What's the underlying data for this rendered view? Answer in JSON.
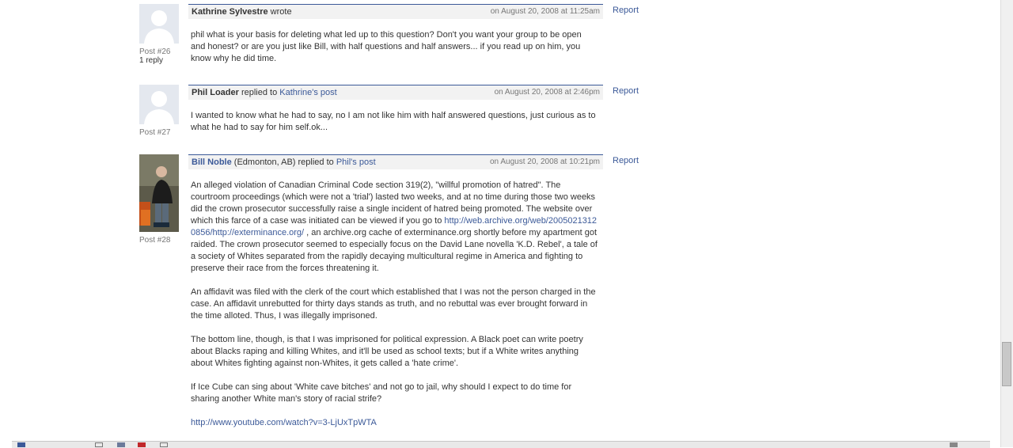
{
  "posts": [
    {
      "author": "Kathrine Sylvestre",
      "action": "wrote",
      "date": "on August 20, 2008 at 11:25am",
      "report": "Report",
      "post_num": "Post #26",
      "replies": "1 reply",
      "paragraphs": [
        "phil what is your basis for deleting what led up to this question? Don't you want your group to be open and honest? or are you just like Bill, with half questions and half answers... if you read up on him, you know why he did time."
      ]
    },
    {
      "author": "Phil Loader",
      "action": "replied to",
      "target": "Kathrine's post",
      "date": "on August 20, 2008 at 2:46pm",
      "report": "Report",
      "post_num": "Post #27",
      "paragraphs": [
        "I wanted to know what he had to say, no I am not like him with half answered questions, just curious as to what he had to say for him self.ok..."
      ]
    },
    {
      "author": "Bill Noble",
      "location": "(Edmonton, AB)",
      "action": "replied to",
      "target": "Phil's post",
      "date": "on August 20, 2008 at 10:21pm",
      "report": "Report",
      "post_num": "Post #28",
      "p1_before": "An alleged violation of Canadian Criminal Code section 319(2), \"willful promotion of hatred\". The courtroom proceedings (which were not a 'trial') lasted two weeks, and at no time during those two weeks did the crown prosecutor successfully raise a single incident of hatred being promoted. The website over which this farce of a case was initiated can be viewed if you go to ",
      "p1_link": "http://web.archive.org/web/20050213120856/http://exterminance.org/",
      "p1_after": " , an archive.org cache of exterminance.org shortly before my apartment got raided. The crown prosecutor seemed to especially focus on the David Lane novella 'K.D. Rebel', a tale of a society of Whites separated from the rapidly decaying multicultural regime in America and fighting to preserve their race from the forces threatening it.",
      "p2": "An affidavit was filed with the clerk of the court which established that I was not the person charged in the case. An affidavit unrebutted for thirty days stands as truth, and no rebuttal was ever brought forward in the time alloted. Thus, I was illegally imprisoned.",
      "p3": "The bottom line, though, is that I was imprisoned for political expression. A Black poet can write poetry about Blacks raping and killing Whites, and it'll be used as school texts; but if a White writes anything about Whites fighting against non-Whites, it gets called a 'hate crime'.",
      "p4": "If Ice Cube can sing about 'White cave bitches' and not go to jail, why should I expect to do time for sharing another White man's story of racial strife?",
      "link": "http://www.youtube.com/watch?v=3-LjUxTpWTA"
    }
  ],
  "colors": {
    "link": "#3b5998",
    "header_border": "#3b5998",
    "header_bg": "#f2f2f2"
  }
}
